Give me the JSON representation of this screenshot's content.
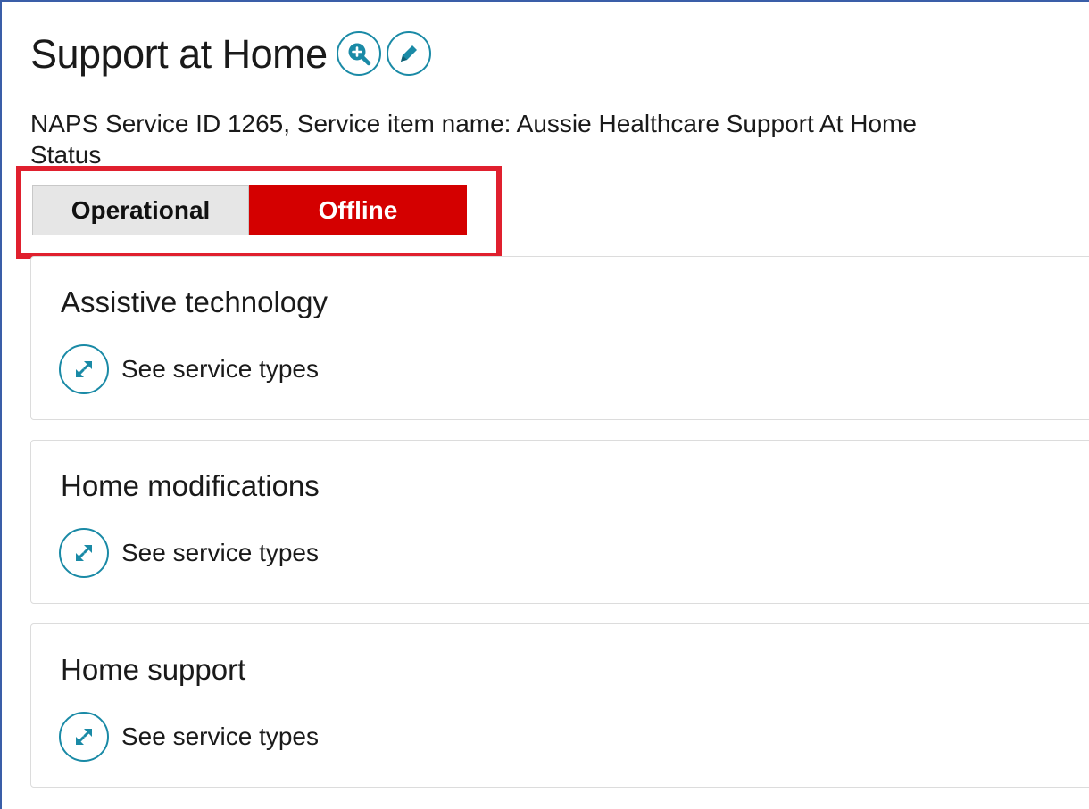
{
  "header": {
    "title": "Support at Home",
    "zoom_icon": "zoom-in-icon",
    "edit_icon": "pencil-icon"
  },
  "service_info": "NAPS Service ID 1265, Service item name: Aussie Healthcare Support At Home",
  "status": {
    "label": "Status",
    "options": [
      "Operational",
      "Offline"
    ],
    "selected": "Offline"
  },
  "categories": [
    {
      "title": "Assistive technology",
      "link_label": "See service types",
      "icon": "expand-icon"
    },
    {
      "title": "Home modifications",
      "link_label": "See service types",
      "icon": "expand-icon"
    },
    {
      "title": "Home support",
      "link_label": "See service types",
      "icon": "expand-icon"
    }
  ],
  "colors": {
    "accent": "#1a8aa6",
    "offline_bg": "#d40000",
    "operational_bg": "#e6e6e6",
    "highlight_border": "#e0202e",
    "frame_border": "#3a5ea8"
  }
}
